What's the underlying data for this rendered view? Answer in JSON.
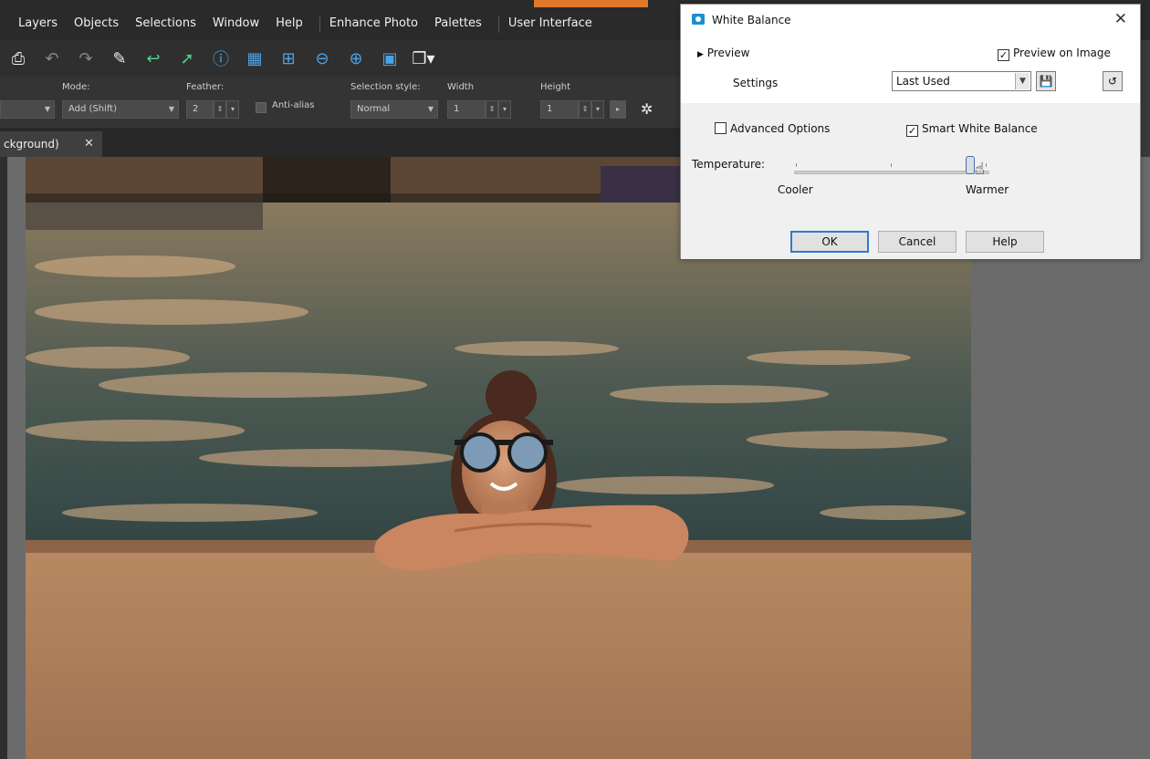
{
  "menu": {
    "items": [
      "Layers",
      "Objects",
      "Selections",
      "Window",
      "Help",
      "Enhance Photo",
      "Palettes",
      "User Interface"
    ]
  },
  "toolbar": {
    "icons": [
      "print-icon",
      "undo-icon",
      "redo-icon",
      "edit-selection-icon",
      "revert-icon",
      "forward-icon",
      "info-icon",
      "calculator-icon",
      "grid-icon",
      "zoom-out-icon",
      "zoom-in-icon",
      "fit-screen-icon",
      "paste-icon"
    ]
  },
  "options": {
    "mode_label": "Mode:",
    "mode_value": "Add (Shift)",
    "feather_label": "Feather:",
    "feather_value": "2",
    "antialias_label": "Anti-alias",
    "selection_style_label": "Selection style:",
    "selection_style_value": "Normal",
    "width_label": "Width",
    "width_value": "1",
    "height_label": "Height",
    "height_value": "1"
  },
  "tab": {
    "label": "ckground)",
    "close": "✕"
  },
  "dialog": {
    "title": "White Balance",
    "close": "✕",
    "preview_label": "Preview",
    "preview_on_image": "Preview on Image",
    "preview_on_image_checked": true,
    "settings_label": "Settings",
    "settings_value": "Last Used",
    "advanced_options": "Advanced Options",
    "advanced_options_checked": false,
    "smart_white_balance": "Smart White Balance",
    "smart_white_balance_checked": true,
    "temperature_label": "Temperature:",
    "cooler": "Cooler",
    "warmer": "Warmer",
    "temperature_level": 0.9,
    "ok": "OK",
    "cancel": "Cancel",
    "help": "Help"
  },
  "colors": {
    "accent": "#e07a2a",
    "dialog_icon": "#1a8fd0",
    "default_button_border": "#2e7ad1"
  }
}
